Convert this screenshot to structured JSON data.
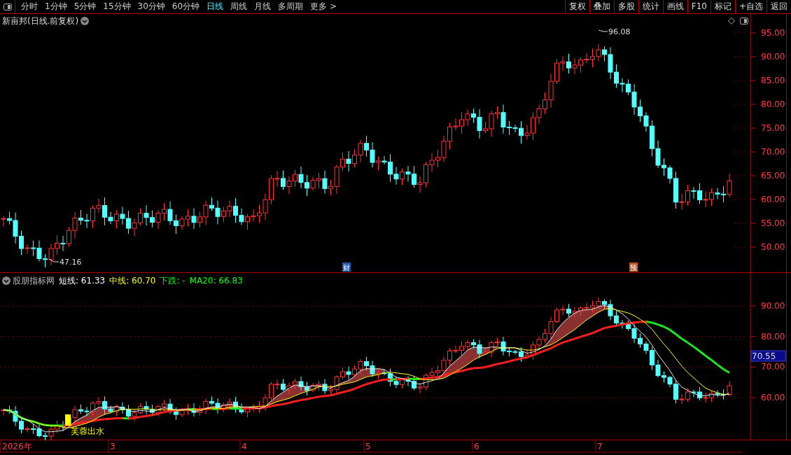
{
  "toolbar": {
    "periods": [
      {
        "label": "分时",
        "selected": false
      },
      {
        "label": "1分钟",
        "selected": false
      },
      {
        "label": "5分钟",
        "selected": false
      },
      {
        "label": "15分钟",
        "selected": false
      },
      {
        "label": "30分钟",
        "selected": false
      },
      {
        "label": "60分钟",
        "selected": false
      },
      {
        "label": "日线",
        "selected": true
      },
      {
        "label": "周线",
        "selected": false
      },
      {
        "label": "月线",
        "selected": false
      },
      {
        "label": "多周期",
        "selected": false
      },
      {
        "label": "更多 >",
        "selected": false
      }
    ],
    "buttons": [
      "复权",
      "叠加",
      "多股",
      "统计",
      "画线",
      "F10",
      "标记",
      "+自选",
      "返回"
    ]
  },
  "main_chart": {
    "title": "新亩邦(日线.前复权)",
    "y_ticks": [
      "95.00",
      "90.00",
      "85.00",
      "80.00",
      "75.00",
      "70.00",
      "65.00",
      "60.00",
      "55.00",
      "50.00"
    ],
    "high_label": "96.08",
    "low_label": "47.16",
    "markers": [
      {
        "label": "财",
        "color": "#1e5aa8"
      },
      {
        "label": "预",
        "color": "#c8501e"
      }
    ]
  },
  "indicator": {
    "name": "股朋指标网",
    "legend": [
      {
        "text": "短线: 61.33",
        "color": "#ffffff"
      },
      {
        "text": "中线: 60.70",
        "color": "#ffff00"
      },
      {
        "text": "下跌: -",
        "color": "#00ff00"
      },
      {
        "text": "MA20: 66.83",
        "color": "#00ff00"
      }
    ],
    "y_ticks": [
      "90.00",
      "80.00",
      "70.00",
      "60.00"
    ],
    "current_value": "70.55",
    "signal_label": "芙蓉出水"
  },
  "date_axis": [
    "2026年",
    "3",
    "4",
    "5",
    "6",
    "7"
  ]
}
